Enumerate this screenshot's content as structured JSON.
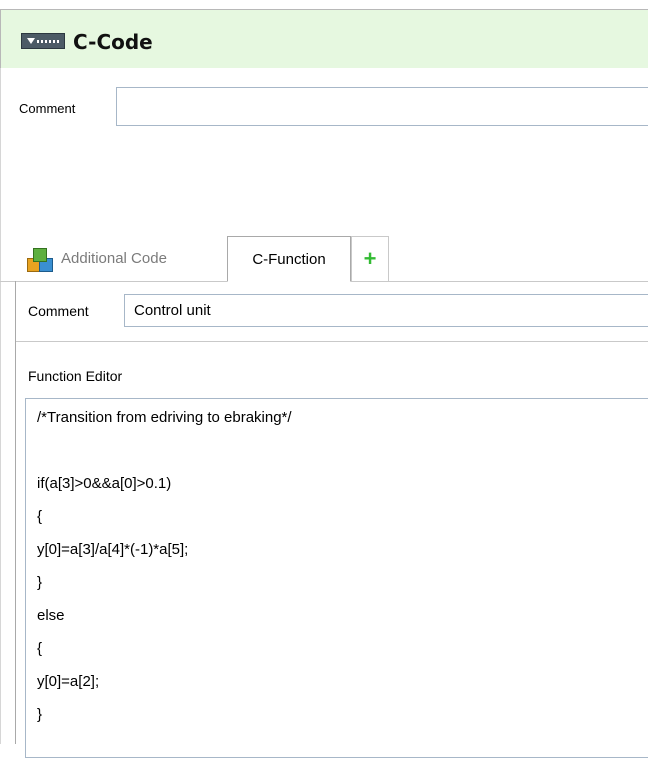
{
  "block": {
    "title": "C-Code",
    "comment_label": "Comment",
    "comment_value": ""
  },
  "tabs": [
    {
      "label": "Additional Code",
      "icon": "package-icon",
      "active": false
    },
    {
      "label": "C-Function",
      "active": true
    },
    {
      "label": "+",
      "icon": "add-tab-icon",
      "color": "#33bb33"
    }
  ],
  "function": {
    "comment_label": "Comment",
    "comment_value": "Control unit",
    "editor_label": "Function Editor",
    "code_lines": [
      "/*Transition from edriving to ebraking*/",
      "",
      "if(a[3]>0&&a[0]>0.1)",
      "{",
      "y[0]=a[3]/a[4]*(-1)*a[5];",
      "}",
      "else",
      "{",
      "y[0]=a[2];",
      "}"
    ]
  },
  "colors": {
    "title_bg": "#e6f8e0",
    "input_border": "#a7b7c8"
  }
}
